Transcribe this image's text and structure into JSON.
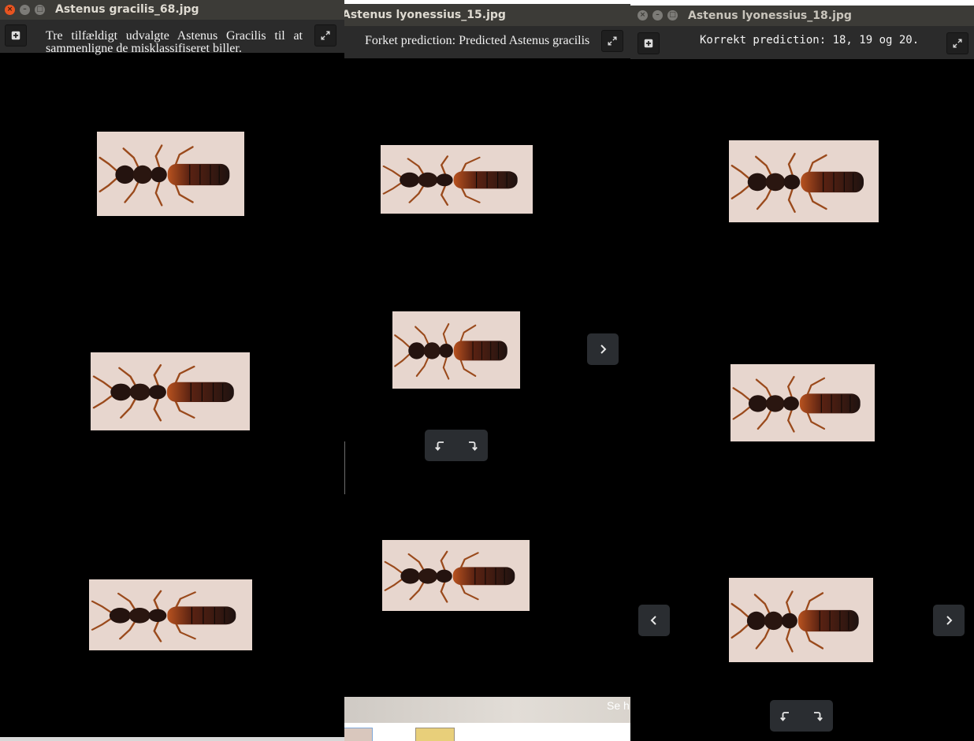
{
  "windows": [
    {
      "title": "Astenus gracilis_68.jpg",
      "caption": "Tre tilfældigt udvalgte Astenus Gracilis til at sammenligne de misklassifiseret biller."
    },
    {
      "title": "Astenus lyonessius_15.jpg",
      "caption": "Forket prediction: Predicted Astenus gracilis"
    },
    {
      "title": "Astenus lyonessius_18.jpg",
      "caption": "Korrekt prediction: 18, 19 og 20."
    }
  ],
  "background_page": {
    "partial_text": "Se h"
  },
  "icons": {
    "add": "plus-icon",
    "expand": "expand-icon",
    "next": "chevron-right-icon",
    "previous": "chevron-left-icon",
    "rotate_left": "rotate-left-icon",
    "rotate_right": "rotate-right-icon",
    "close": "close-icon",
    "minimize": "minimize-icon",
    "maximize": "maximize-icon"
  },
  "colors": {
    "titlebar": "#3c3b37",
    "toolbar": "#2b2b2b",
    "viewer_background": "#000000",
    "close_button_active": "#e95420",
    "button_inactive": "#7c7b77",
    "nav_button": "#2a2d31"
  }
}
